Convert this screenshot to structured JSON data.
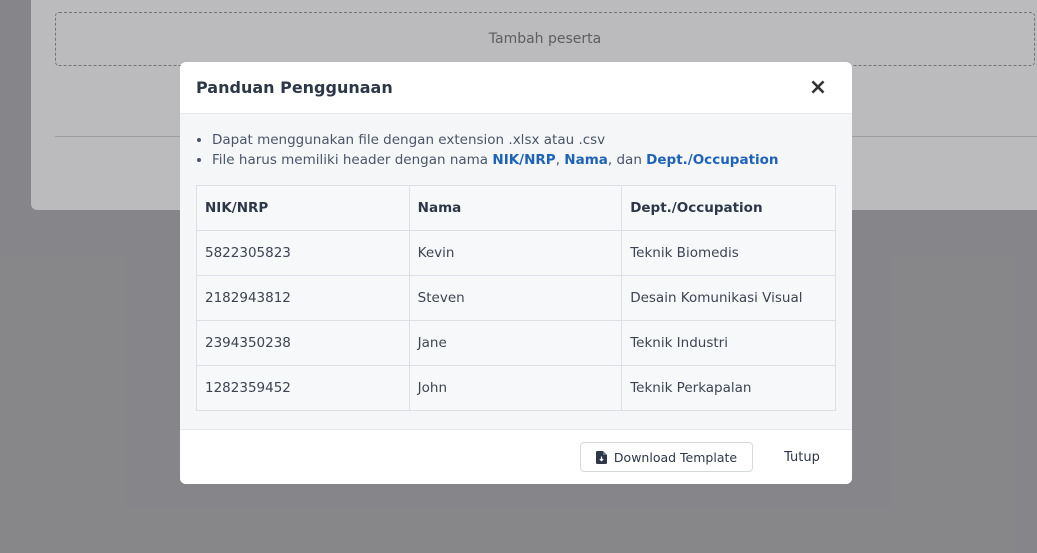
{
  "background": {
    "add_participant_label": "Tambah peserta"
  },
  "modal": {
    "title": "Panduan Penggunaan",
    "close_icon": "close-icon",
    "guide": {
      "line1": "Dapat menggunakan file dengan extension .xlsx atau .csv",
      "line2_prefix": "File harus memiliki header dengan nama ",
      "line2_h1": "NIK/NRP",
      "line2_sep1": ", ",
      "line2_h2": "Nama",
      "line2_sep2": ", dan ",
      "line2_h3": "Dept./Occupation",
      "highlight_color": "#1e63b8"
    },
    "table": {
      "headers": [
        "NIK/NRP",
        "Nama",
        "Dept./Occupation"
      ],
      "rows": [
        [
          "5822305823",
          "Kevin",
          "Teknik Biomedis"
        ],
        [
          "2182943812",
          "Steven",
          "Desain Komunikasi Visual"
        ],
        [
          "2394350238",
          "Jane",
          "Teknik Industri"
        ],
        [
          "1282359452",
          "John",
          "Teknik Perkapalan"
        ]
      ]
    },
    "footer": {
      "download_label": "Download Template",
      "download_icon": "file-download-icon",
      "close_label": "Tutup"
    }
  }
}
